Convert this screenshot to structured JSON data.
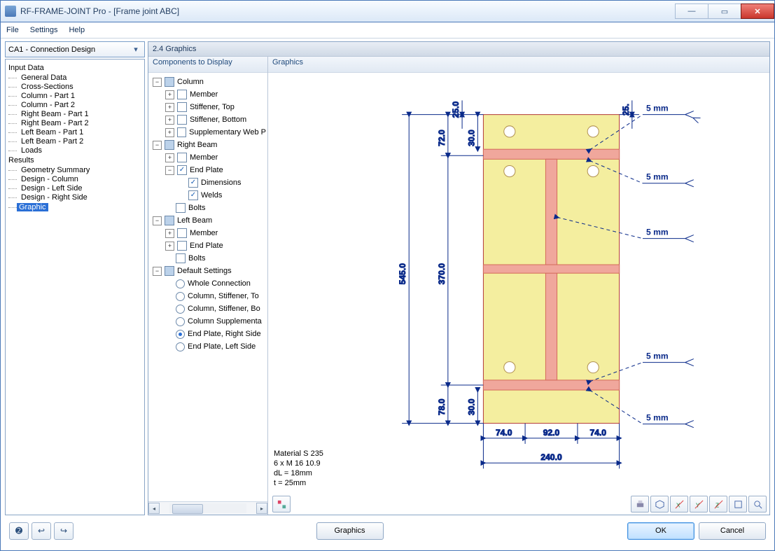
{
  "window": {
    "title": "RF-FRAME-JOINT Pro - [Frame joint ABC]"
  },
  "menu": {
    "file": "File",
    "settings": "Settings",
    "help": "Help"
  },
  "dropdown": {
    "value": "CA1 - Connection Design"
  },
  "nav": {
    "input_hdr": "Input Data",
    "input": [
      "General Data",
      "Cross-Sections",
      "Column - Part 1",
      "Column - Part 2",
      "Right Beam - Part 1",
      "Right Beam - Part 2",
      "Left Beam - Part 1",
      "Left Beam - Part 2",
      "Loads"
    ],
    "results_hdr": "Results",
    "results": [
      "Geometry Summary",
      "Design - Column",
      "Design - Left Side",
      "Design - Right Side"
    ],
    "results_sel": "Graphic"
  },
  "panel": {
    "title": "2.4 Graphics",
    "components_hdr": "Components to Display",
    "graphics_hdr": "Graphics"
  },
  "tree": {
    "column": "Column",
    "member": "Member",
    "stiff_top": "Stiffener, Top",
    "stiff_bot": "Stiffener, Bottom",
    "supp_web": "Supplementary Web P",
    "right_beam": "Right Beam",
    "end_plate": "End Plate",
    "dimensions": "Dimensions",
    "welds": "Welds",
    "bolts": "Bolts",
    "left_beam": "Left Beam",
    "defaults": "Default Settings",
    "d1": "Whole Connection",
    "d2": "Column, Stiffener, To",
    "d3": "Column, Stiffener, Bo",
    "d4": "Column Supplementa",
    "d5": "End Plate, Right Side",
    "d6": "End Plate, Left Side"
  },
  "dims": {
    "h_total": "545.0",
    "h_mid": "370.0",
    "h_top": "72.0",
    "h_topcap": "25.0",
    "h_bot": "78.0",
    "g_top": "30.0",
    "g_bot": "30.0",
    "g_right": "25.",
    "w1": "74.0",
    "w2": "92.0",
    "w3": "74.0",
    "w_total": "240.0",
    "weld": "5 mm"
  },
  "notes": {
    "l1": "Material S 235",
    "l2": "6 x M 16 10.9",
    "l3": "dL = 18mm",
    "l4": "t = 25mm"
  },
  "buttons": {
    "graphics": "Graphics",
    "ok": "OK",
    "cancel": "Cancel"
  }
}
